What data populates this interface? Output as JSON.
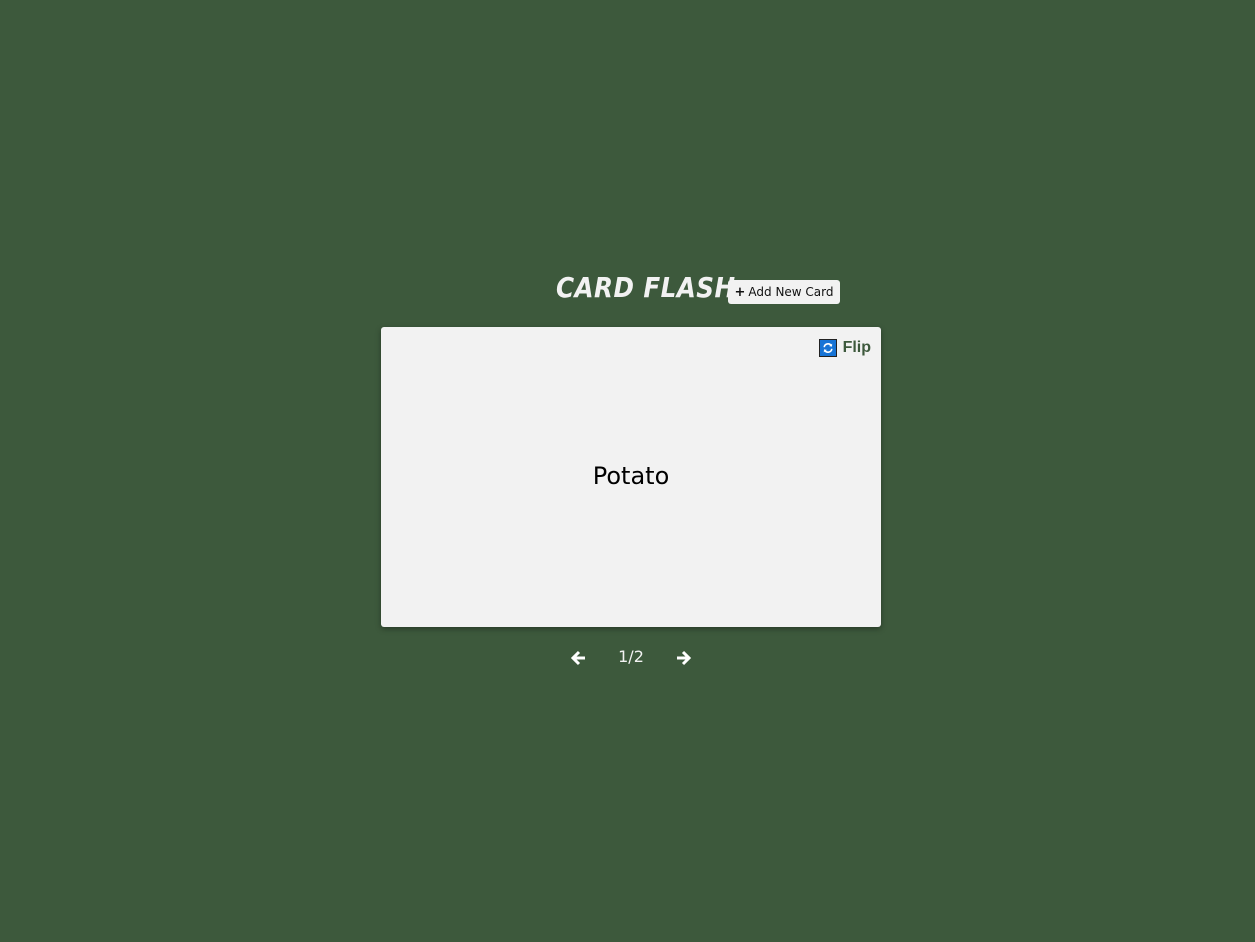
{
  "app": {
    "title": "CARD FLASH",
    "add_button_label": "Add New Card",
    "add_button_icon": "plus-icon"
  },
  "card": {
    "flip_label": "Flip",
    "flip_icon": "refresh-icon",
    "text": "Potato"
  },
  "pager": {
    "prev_icon": "arrow-left-icon",
    "next_icon": "arrow-right-icon",
    "current": 1,
    "total": 2,
    "label": "1/2"
  },
  "colors": {
    "background": "#3d593c",
    "card": "#f2f2f2",
    "flip_icon": "#1774d6",
    "flip_text": "#3d593c"
  }
}
